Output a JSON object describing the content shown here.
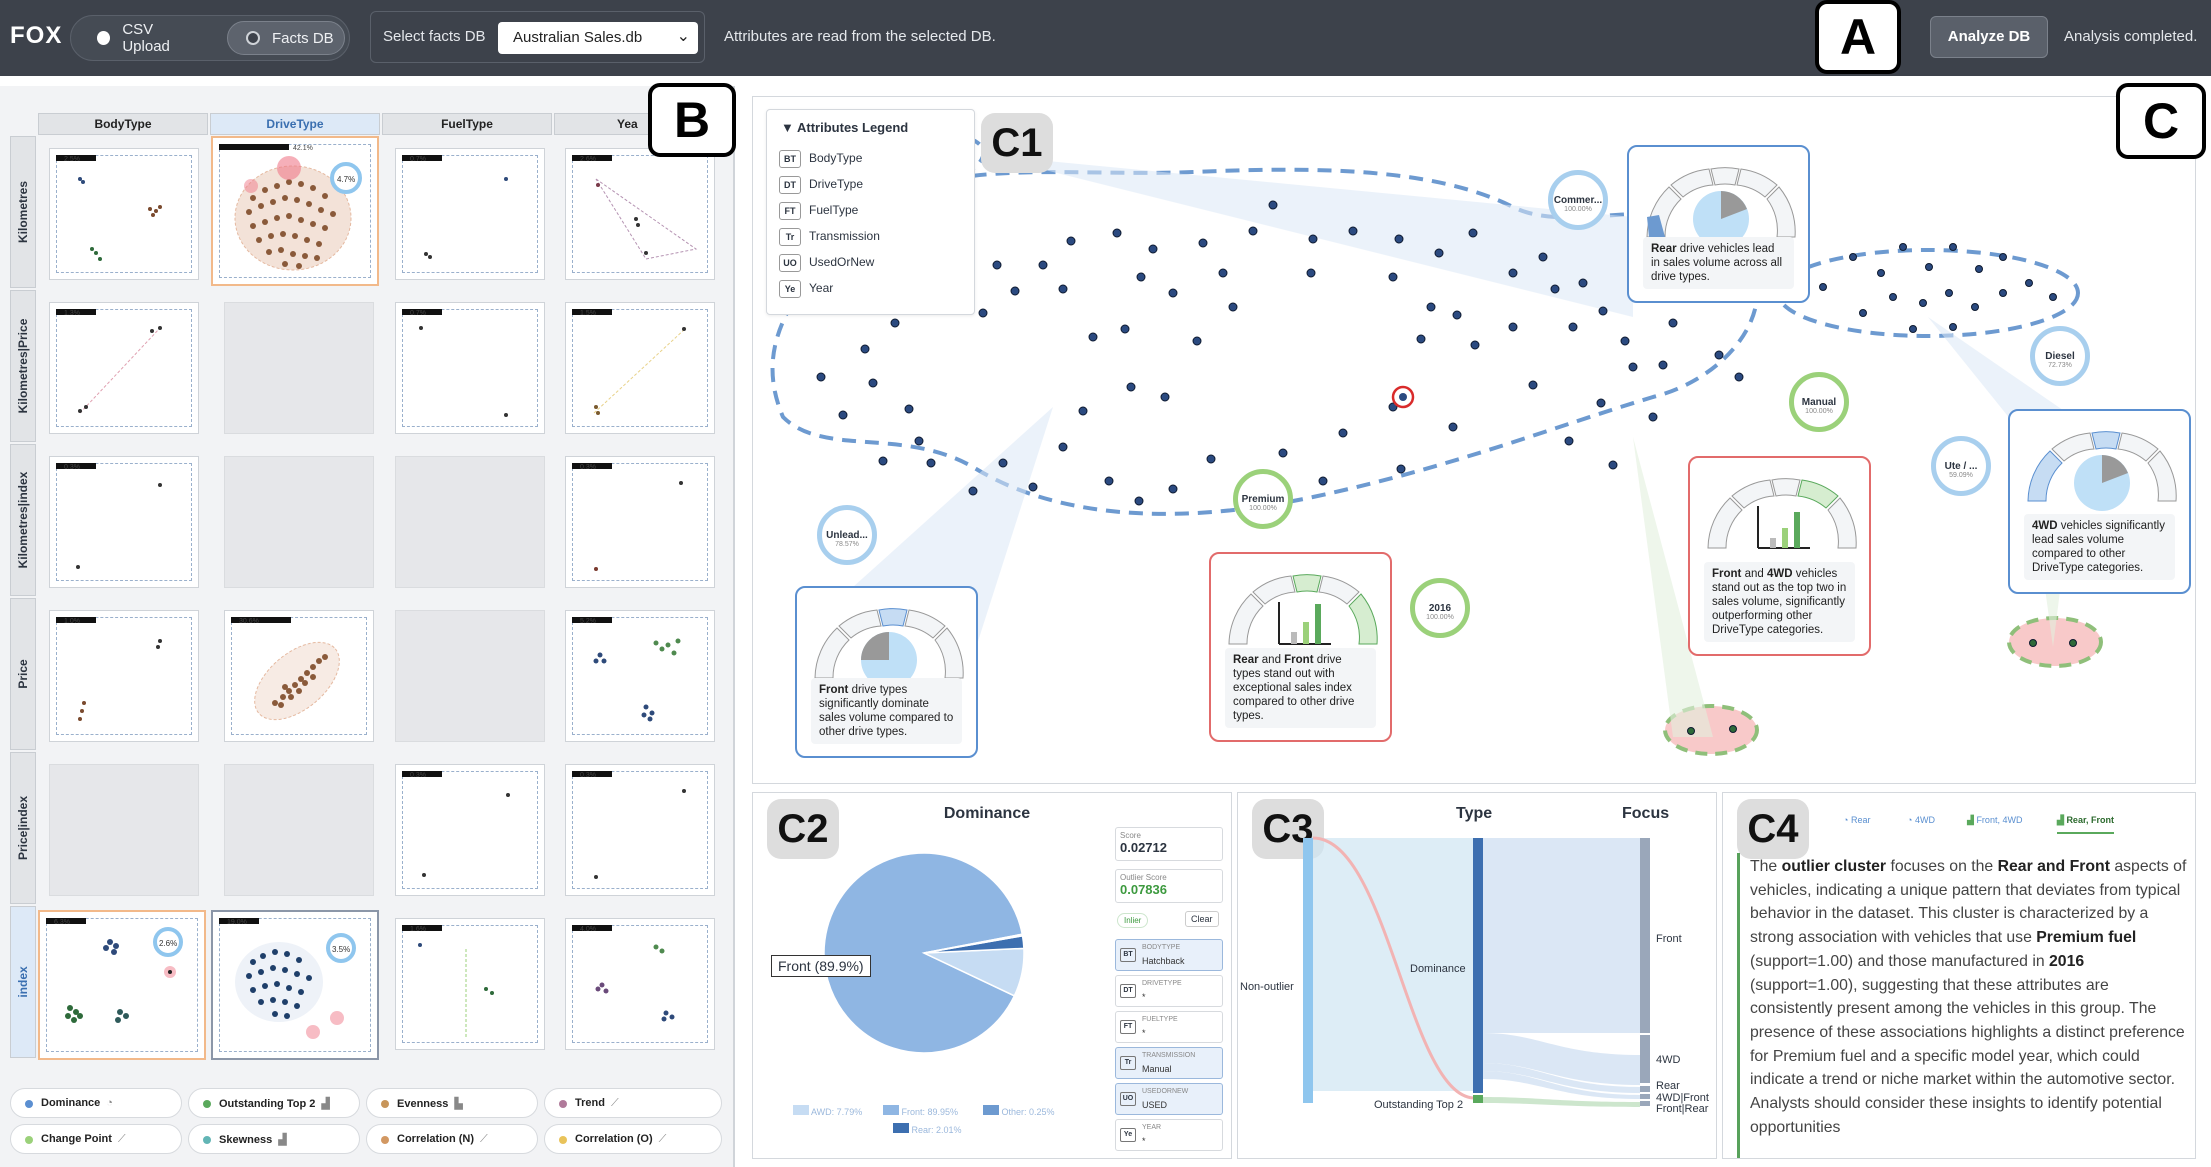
{
  "app": {
    "name": "FOX"
  },
  "toolbar": {
    "source_options": [
      "CSV Upload",
      "Facts DB"
    ],
    "selected_source": "Facts DB",
    "db_label": "Select facts DB",
    "db_value": "Australian Sales.db",
    "info": "Attributes are read from the selected DB.",
    "analyze_label": "Analyze DB",
    "status": "Analysis completed."
  },
  "callouts": {
    "a": "A",
    "b": "B",
    "c": "C",
    "c1": "C1",
    "c2": "C2",
    "c3": "C3",
    "c4": "C4"
  },
  "matrix": {
    "columns": [
      "BodyType",
      "DriveType",
      "FuelType",
      "Yea"
    ],
    "active_column": "DriveType",
    "rows": [
      "Kilometres",
      "Kilometres|Price",
      "Kilometres|index",
      "Price",
      "Price|index",
      "index"
    ],
    "active_row": "index",
    "cells": [
      [
        "2.5%",
        "42.1%",
        "0.7%",
        "2.6%"
      ],
      [
        "1.3%",
        "",
        "0.7%",
        "1.5%"
      ],
      [
        "0.3%",
        "",
        "",
        "0.3%"
      ],
      [
        "1.0%",
        "30.6%",
        "",
        "5.2%"
      ],
      [
        "",
        "",
        "0.3%",
        "0.3%"
      ],
      [
        "6.3%",
        "19.0%",
        "1.6%",
        "4.0%"
      ]
    ],
    "cell_ring_labels": {
      "kd": "4.7%",
      "ib": "2.6%",
      "id": "3.5%"
    }
  },
  "fact_types": [
    {
      "label": "Dominance",
      "color": "#5b8fd1"
    },
    {
      "label": "Outstanding Top 2",
      "color": "#5aa95c"
    },
    {
      "label": "Evenness",
      "color": "#c7955a"
    },
    {
      "label": "Trend",
      "color": "#b07a9a"
    },
    {
      "label": "Change Point",
      "color": "#9bd17a"
    },
    {
      "label": "Skewness",
      "color": "#62b5b5"
    },
    {
      "label": "Correlation (N)",
      "color": "#d29862"
    },
    {
      "label": "Correlation (O)",
      "color": "#e9c35a"
    }
  ],
  "legend": {
    "title": "Attributes Legend",
    "items": [
      {
        "badge": "BT",
        "label": "BodyType"
      },
      {
        "badge": "DT",
        "label": "DriveType"
      },
      {
        "badge": "FT",
        "label": "FuelType"
      },
      {
        "badge": "Tr",
        "label": "Transmission"
      },
      {
        "badge": "UO",
        "label": "UsedOrNew"
      },
      {
        "badge": "Ye",
        "label": "Year"
      }
    ]
  },
  "gauge_labels": [
    "BT",
    "DT",
    "FT",
    "Tr",
    "UO",
    "Ye"
  ],
  "insight_cards": [
    {
      "bold": "Rear",
      "text": " drive vehicles lead in sales volume across all drive types."
    },
    {
      "bold": "Front",
      "text": " drive types significantly dominate sales volume compared to other drive types."
    },
    {
      "bold": "Rear",
      "mid": " and ",
      "bold2": "Front",
      "text": " drive types stand out with exceptional sales index compared to other drive types."
    },
    {
      "bold": "Front",
      "mid": " and ",
      "bold2": "4WD",
      "text": " vehicles stand out as the top two in sales volume, significantly outperforming other DriveType categories."
    },
    {
      "bold": "4WD",
      "text": " vehicles significantly lead sales volume compared to other DriveType categories."
    }
  ],
  "bubbles": [
    {
      "name": "Commer...",
      "value": "100.00%"
    },
    {
      "name": "Unlead...",
      "value": "78.57%"
    },
    {
      "name": "Premium",
      "value": "100.00%"
    },
    {
      "name": "2016",
      "value": "100.00%"
    },
    {
      "name": "Manual",
      "value": "100.00%"
    },
    {
      "name": "Diesel",
      "value": "72.73%"
    },
    {
      "name": "Ute / ...",
      "value": "59.09%"
    }
  ],
  "c2": {
    "title": "Dominance",
    "pie_label": "Front (89.9%)",
    "score_label": "Score",
    "score": "0.02712",
    "outlier_label": "Outlier Score",
    "outlier_score": "0.07836",
    "inlier": "Inlier",
    "clear": "Clear",
    "attrs": [
      {
        "badge": "BT",
        "key": "BODYTYPE",
        "value": "Hatchback",
        "on": true
      },
      {
        "badge": "DT",
        "key": "DRIVETYPE",
        "value": "*",
        "on": false
      },
      {
        "badge": "FT",
        "key": "FUELTYPE",
        "value": "*",
        "on": false
      },
      {
        "badge": "Tr",
        "key": "TRANSMISSION",
        "value": "Manual",
        "on": true
      },
      {
        "badge": "UO",
        "key": "USEDORNEW",
        "value": "USED",
        "on": true
      },
      {
        "badge": "Ye",
        "key": "YEAR",
        "value": "*",
        "on": false
      }
    ],
    "legend": [
      "AWD: 7.79%",
      "Front: 89.95%",
      "Other: 0.25%",
      "Rear: 2.01%"
    ]
  },
  "chart_data": {
    "type": "pie",
    "title": "Dominance",
    "categories": [
      "Front",
      "AWD",
      "Rear",
      "Other"
    ],
    "values": [
      89.95,
      7.79,
      2.01,
      0.25
    ]
  },
  "c3": {
    "type_label": "Type",
    "focus_label": "Focus",
    "left": [
      "Non-outlier",
      "Outstanding Top 2"
    ],
    "mid": [
      "Dominance"
    ],
    "right": [
      "Front",
      "4WD",
      "Rear",
      "4WD|Front",
      "Front|Rear"
    ]
  },
  "c4": {
    "tabs": [
      "Rear",
      "4WD",
      "Front, 4WD",
      "Rear, Front"
    ],
    "text_parts": [
      {
        "t": "The "
      },
      {
        "b": "outlier cluster"
      },
      {
        "t": " focuses on the "
      },
      {
        "b": "Rear and Front"
      },
      {
        "t": " aspects of vehicles, indicating a unique pattern that deviates from typical behavior in the dataset. This cluster is characterized by a strong association with vehicles that use "
      },
      {
        "b": "Premium fuel"
      },
      {
        "t": " (support=1.00) and those manufactured in "
      },
      {
        "b": "2016"
      },
      {
        "t": " (support=1.00), suggesting that these attributes are consistently present among the vehicles in this group. The presence of these associations highlights a distinct preference for Premium fuel and a specific model year, which could indicate a trend or niche market within the automotive sector. Analysts should consider these insights to identify potential opportunities"
      }
    ]
  }
}
